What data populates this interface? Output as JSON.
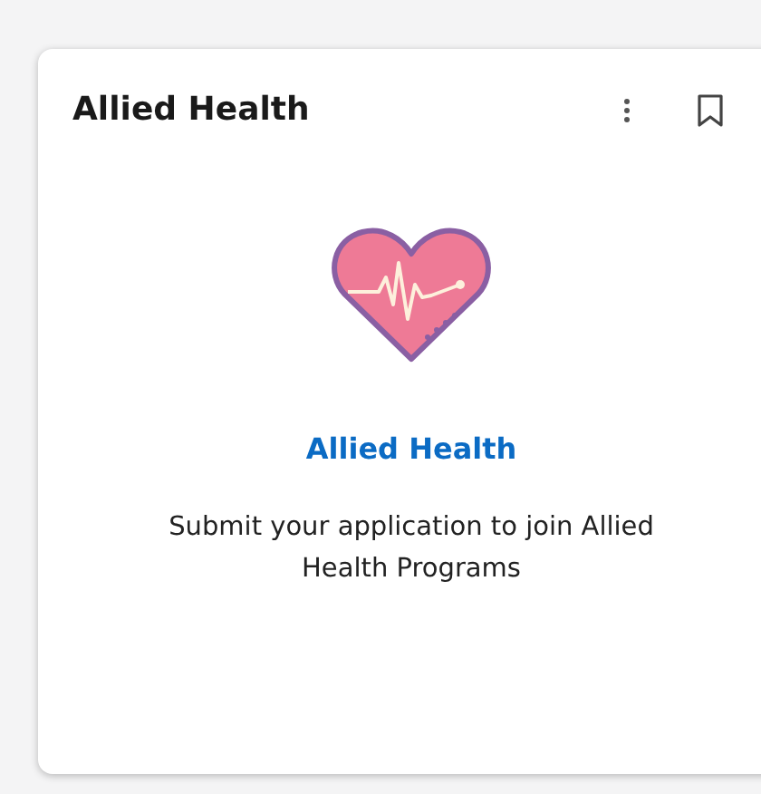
{
  "card": {
    "title": "Allied Health",
    "link": "Allied Health",
    "description": "Submit your application to join Allied Health Programs"
  }
}
